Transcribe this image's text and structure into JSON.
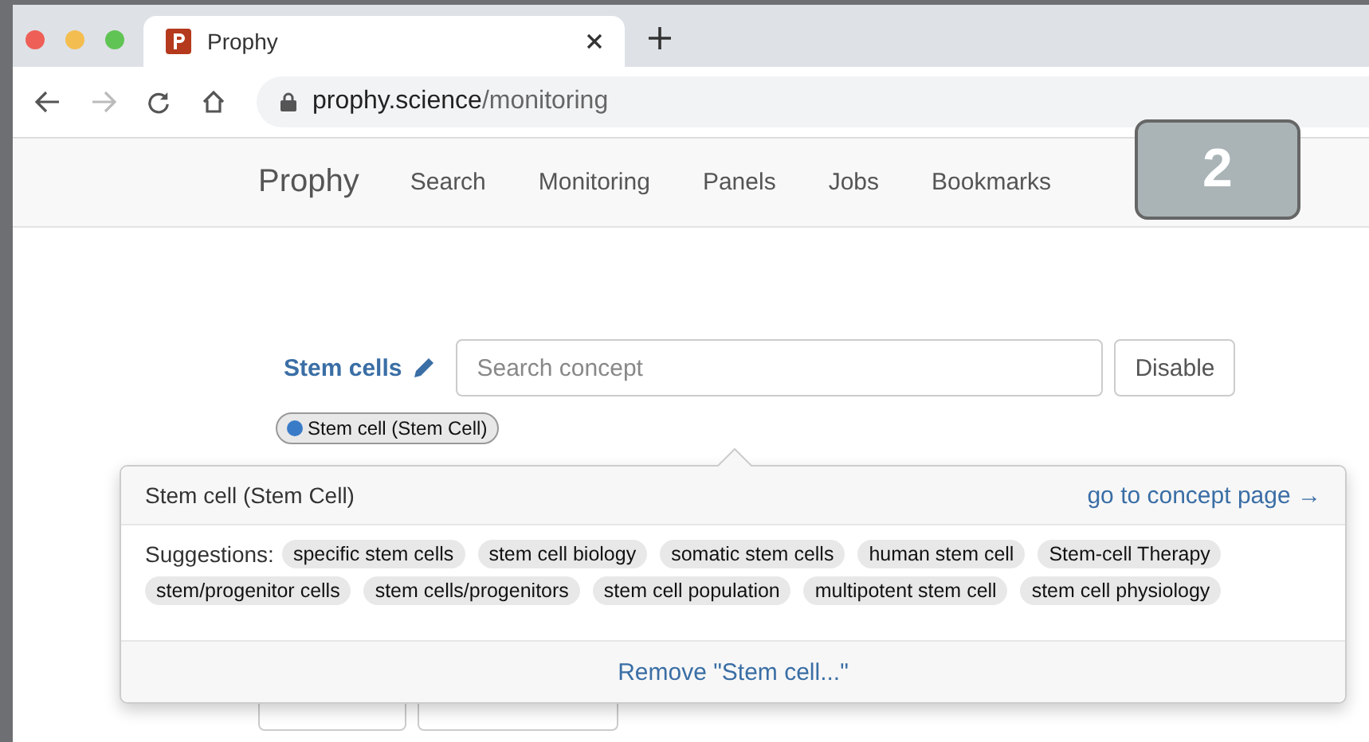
{
  "browser": {
    "tab_title": "Prophy",
    "url_host": "prophy.science",
    "url_path": "/monitoring"
  },
  "nav": {
    "brand": "Prophy",
    "links": [
      "Search",
      "Monitoring",
      "Panels",
      "Jobs",
      "Bookmarks"
    ]
  },
  "step_badge": "2",
  "topic": {
    "name": "Stem cells",
    "search": {
      "placeholder": "Search concept"
    },
    "disable_button": "Disable",
    "concepts": [
      {
        "label": "Stem cell (Stem Cell)",
        "color": "#3a7bc8"
      }
    ]
  },
  "actions": [
    {
      "kind": "button"
    },
    {
      "kind": "button"
    }
  ],
  "popover": {
    "title": "Stem cell (Stem Cell)",
    "link": "go to concept page →",
    "suggestions_label": "Suggestions:",
    "suggestions": [
      "specific stem cells",
      "stem cell biology",
      "somatic stem cells",
      "human stem cell",
      "Stem-cell Therapy",
      "stem/progenitor cells",
      "stem cells/progenitors",
      "stem cell population",
      "multipotent stem cell",
      "stem cell physiology"
    ],
    "remove": "Remove \"Stem cell...\""
  }
}
